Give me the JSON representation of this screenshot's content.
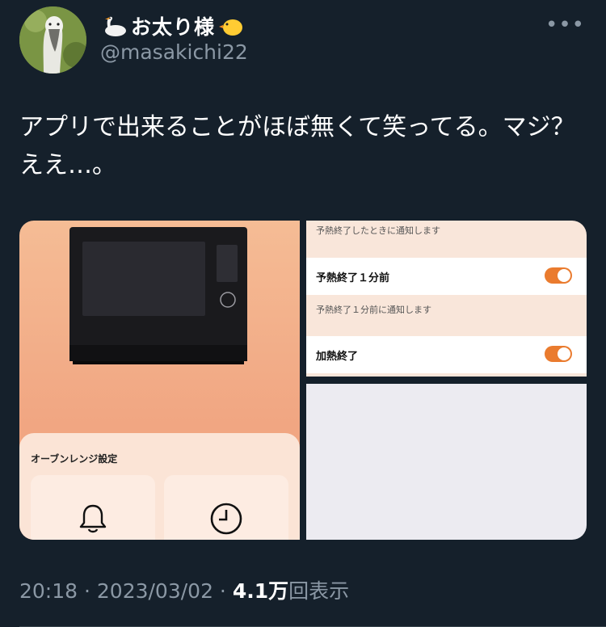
{
  "author": {
    "display_name": "お太り様",
    "handle": "@masakichi22",
    "name_emoji_left": "swan",
    "name_emoji_right": "baby-chick"
  },
  "menu": {
    "more_label": "•••"
  },
  "tweet": {
    "text": "アプリで出来ることがほぼ無くて笑ってる。マジ？\nええ…。"
  },
  "media": {
    "left": {
      "settings_title": "オーブンレンジ設定",
      "tile_icons": [
        "bell-icon",
        "clock-icon"
      ],
      "background_color": "#f3ad87"
    },
    "right": {
      "desc_1": "予熱終了したときに通知します",
      "row_1": {
        "label": "予熱終了１分前",
        "toggle_on": true
      },
      "desc_2": "予熱終了１分前に通知します",
      "row_2": {
        "label": "加熱終了",
        "toggle_on": true
      },
      "toggle_color": "#ea7b2e"
    }
  },
  "meta": {
    "time": "20:18",
    "sep1": " · ",
    "date": "2023/03/02",
    "sep2": " · ",
    "views_count": "4.1万",
    "views_label": "回表示"
  }
}
